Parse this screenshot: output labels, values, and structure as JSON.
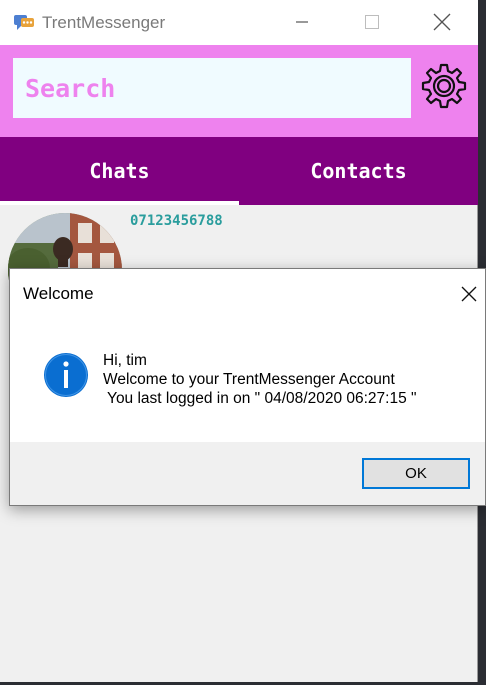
{
  "window": {
    "title": "TrentMessenger",
    "icon": "messenger-app-icon",
    "controls": [
      "minimize-icon",
      "maximize-icon",
      "close-icon"
    ]
  },
  "search": {
    "placeholder": "Search",
    "value": "",
    "settings_icon": "gear-icon"
  },
  "tabs": [
    {
      "label": "Chats",
      "active": true
    },
    {
      "label": "Contacts",
      "active": false
    }
  ],
  "chats": [
    {
      "name": "07123456788",
      "avatar": "profile-photo"
    }
  ],
  "dialog": {
    "title": "Welcome",
    "icon": "info-icon",
    "message_line1": "Hi, tim",
    "message_line2": "Welcome to your TrentMessenger Account",
    "message_line3": " You last logged in on \" 04/08/2020 06:27:15 \"",
    "ok_label": "OK"
  },
  "colors": {
    "search_bar_bg": "#ee82ee",
    "tab_bar_bg": "#800080",
    "phone_text": "#2a9d9d",
    "ok_border": "#0078d7"
  }
}
